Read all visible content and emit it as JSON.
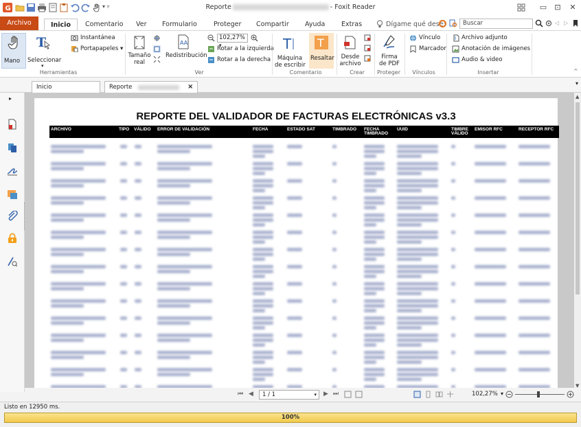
{
  "window": {
    "title_left": "Reporte",
    "title_right": "- Foxit Reader",
    "minimize_glyph": "▭",
    "restore_glyph": "⊡",
    "close_glyph": "✕"
  },
  "tabs": {
    "file": "Archivo",
    "items": [
      "Inicio",
      "Comentario",
      "Ver",
      "Formulario",
      "Proteger",
      "Compartir",
      "Ayuda",
      "Extras"
    ],
    "tellme": "Dígame qué dese:",
    "search_placeholder": "Buscar"
  },
  "ribbon": {
    "mano": "Mano",
    "seleccionar": "Seleccionar",
    "instantanea": "Instantánea",
    "portapapeles": "Portapapeles",
    "herramientas": "Herramientas",
    "tamano_1": "Tamaño",
    "tamano_2": "real",
    "redistribucion": "Redistribución",
    "zoom": "102,27%",
    "rotar_izq": "Rotar a la izquierda",
    "rotar_der": "Rotar a la derecha",
    "ver": "Ver",
    "maquina_1": "Máquina",
    "maquina_2": "de escribir",
    "resaltar": "Resaltar",
    "comentario": "Comentario",
    "desde_1": "Desde",
    "desde_2": "archivo",
    "crear": "Crear",
    "firma_1": "Firma",
    "firma_2": "de PDF",
    "proteger": "Proteger",
    "vinculo": "Vínculo",
    "marcador": "Marcador",
    "vinculos": "Vínculos",
    "archivo_adjunto": "Archivo adjunto",
    "anotacion_imagenes": "Anotación de imágenes",
    "audio_video": "Audio & video",
    "insertar": "Insertar"
  },
  "doc_tabs": {
    "inicio": "Inicio",
    "reporte": "Reporte",
    "close_glyph": "×"
  },
  "report": {
    "title": "REPORTE DEL VALIDADOR DE FACTURAS ELECTRÓNICAS v3.3",
    "columns": [
      "ARCHIVO",
      "TIPO",
      "VÁLIDO",
      "ERROR DE VALIDACIÓN",
      "FECHA",
      "ESTADO SAT",
      "TIMBRADO",
      "FECHA TIMBRADO",
      "UUID",
      "TIMBRE VÁLIDO",
      "EMISOR RFC",
      "RECEPTOR RFC"
    ]
  },
  "nav": {
    "page": "1 / 1",
    "zoom": "102,27%"
  },
  "status": {
    "text": "Listo en 12950 ms.",
    "progress_label": "100%",
    "progress": 1.0
  }
}
